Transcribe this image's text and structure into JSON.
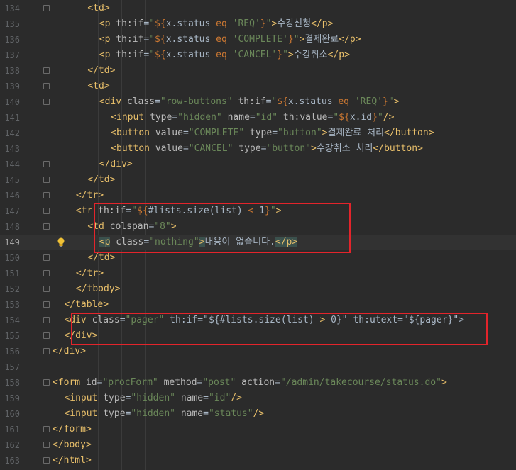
{
  "editor": {
    "language": "html-thymeleaf",
    "current_line": 149,
    "lines": [
      {
        "n": "134",
        "t": "<td>"
      },
      {
        "n": "135",
        "t": "<p th:if=\"${x.status eq 'REQ'}\">수강신청</p>"
      },
      {
        "n": "136",
        "t": "<p th:if=\"${x.status eq 'COMPLETE'}\">결제완료</p>"
      },
      {
        "n": "137",
        "t": "<p th:if=\"${x.status eq 'CANCEL'}\">수강취소</p>"
      },
      {
        "n": "138",
        "t": "</td>"
      },
      {
        "n": "139",
        "t": "<td>"
      },
      {
        "n": "140",
        "t": "<div class=\"row-buttons\" th:if=\"${x.status eq 'REQ'}\">"
      },
      {
        "n": "141",
        "t": "<input type=\"hidden\" name=\"id\" th:value=\"${x.id}\"/>"
      },
      {
        "n": "142",
        "t": "<button value=\"COMPLETE\" type=\"button\">결제완료 처리</button>"
      },
      {
        "n": "143",
        "t": "<button value=\"CANCEL\" type=\"button\">수강취소 처리</button>"
      },
      {
        "n": "144",
        "t": "</div>"
      },
      {
        "n": "145",
        "t": "</td>"
      },
      {
        "n": "146",
        "t": "</tr>"
      },
      {
        "n": "147",
        "t": "<tr th:if=\"${#lists.size(list) < 1}\">"
      },
      {
        "n": "148",
        "t": "<td colspan=\"8\">"
      },
      {
        "n": "149",
        "t": "<p class=\"nothing\">내용이 없습니다.</p>"
      },
      {
        "n": "150",
        "t": "</td>"
      },
      {
        "n": "151",
        "t": "</tr>"
      },
      {
        "n": "152",
        "t": "</tbody>"
      },
      {
        "n": "153",
        "t": "</table>"
      },
      {
        "n": "154",
        "t": "<div class=\"pager\" th:if=\"${#lists.size(list) > 0}\" th:utext=\"${pager}\">"
      },
      {
        "n": "155",
        "t": "</div>"
      },
      {
        "n": "156",
        "t": "</div>"
      },
      {
        "n": "157",
        "t": ""
      },
      {
        "n": "158",
        "t": "<form id=\"procForm\" method=\"post\" action=\"/admin/takecourse/status.do\">"
      },
      {
        "n": "159",
        "t": "<input type=\"hidden\" name=\"id\"/>"
      },
      {
        "n": "160",
        "t": "<input type=\"hidden\" name=\"status\"/>"
      },
      {
        "n": "161",
        "t": "</form>"
      },
      {
        "n": "162",
        "t": "</body>"
      },
      {
        "n": "163",
        "t": "</html>"
      }
    ]
  },
  "colors": {
    "background": "#2b2b2b",
    "current_line": "#323232",
    "tag": "#e8bf6a",
    "attribute": "#bababa",
    "string": "#6a8759",
    "keyword": "#cc7832",
    "line_number": "#606366",
    "highlight_box": "#e3242b"
  },
  "icons": {
    "intention_bulb": "lightbulb-icon",
    "fold_marker": "fold-icon"
  }
}
